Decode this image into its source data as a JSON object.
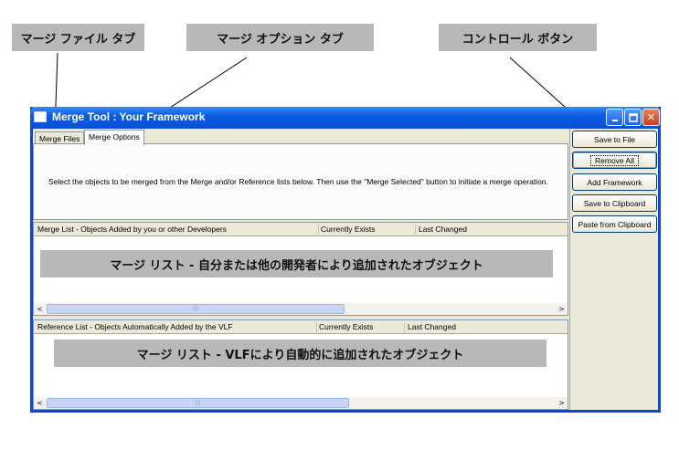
{
  "callouts": {
    "merge_files_tab": "マージ ファイル タブ",
    "merge_options_tab": "マージ オプション タブ",
    "control_buttons": "コントロール ボタン"
  },
  "window": {
    "title": "Merge Tool : Your Framework",
    "icon": "window-app-icon",
    "controls": {
      "minimize_icon": "minimize-icon",
      "maximize_icon": "maximize-icon",
      "close_icon": "close-icon",
      "close_glyph": "✕"
    }
  },
  "tabs": [
    {
      "label": "Merge Files",
      "active": false
    },
    {
      "label": "Merge Options",
      "active": true
    }
  ],
  "instructions": "Select the objects to be merged from the Merge and/or Reference lists below. Then use the \"Merge Selected\" button to initiate a merge operation.",
  "merge_list": {
    "columns": [
      "Merge List - Objects Added by you or other Developers",
      "Currently Exists",
      "Last Changed"
    ],
    "overlay_label": "マージ リスト - 自分または他の開発者により追加されたオブジェクト"
  },
  "reference_list": {
    "columns": [
      "Reference List - Objects Automatically Added by the VLF",
      "Currently Exists",
      "Last Changed"
    ],
    "overlay_label": "マージ リスト - VLFにより自動的に追加されたオブジェクト"
  },
  "scroll": {
    "left_glyph": "<",
    "right_glyph": ">",
    "grip": "|||"
  },
  "buttons": [
    {
      "label": "Save to File"
    },
    {
      "label": "Remove All"
    },
    {
      "label": "Add Framework"
    },
    {
      "label": "Save to Clipboard"
    },
    {
      "label": "Paste from Clipboard"
    }
  ],
  "colors": {
    "titlebar": "#0a5ce6",
    "window_bg": "#ece9d8",
    "callout_bg": "#b8b8b8",
    "close_button": "#c84018"
  }
}
